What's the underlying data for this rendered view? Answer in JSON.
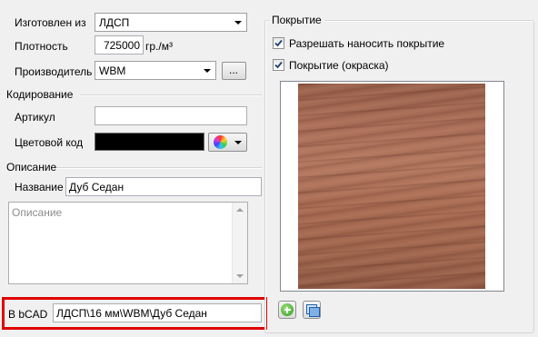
{
  "made_of": {
    "label": "Изготовлен из",
    "value": "ЛДСП"
  },
  "density": {
    "label": "Плотность",
    "value": "725000",
    "unit": "гр./м³"
  },
  "manufacturer": {
    "label": "Производитель",
    "value": "WBM",
    "browse_label": "..."
  },
  "coding": {
    "title": "Кодирование",
    "article_label": "Артикул",
    "article_value": "",
    "color_code_label": "Цветовой код",
    "color_value": "#000000"
  },
  "description": {
    "title": "Описание",
    "name_label": "Название",
    "name_value": "Дуб Седан",
    "desc_placeholder": "Описание"
  },
  "bcad": {
    "label": "В bCAD",
    "path": "ЛДСП\\16 мм\\WBM\\Дуб Седан"
  },
  "coating": {
    "title": "Покрытие",
    "allow_label": "Разрешать наносить покрытие",
    "allow_checked": true,
    "paint_label": "Покрытие (окраска)",
    "paint_checked": true
  },
  "accent": "#e00000"
}
